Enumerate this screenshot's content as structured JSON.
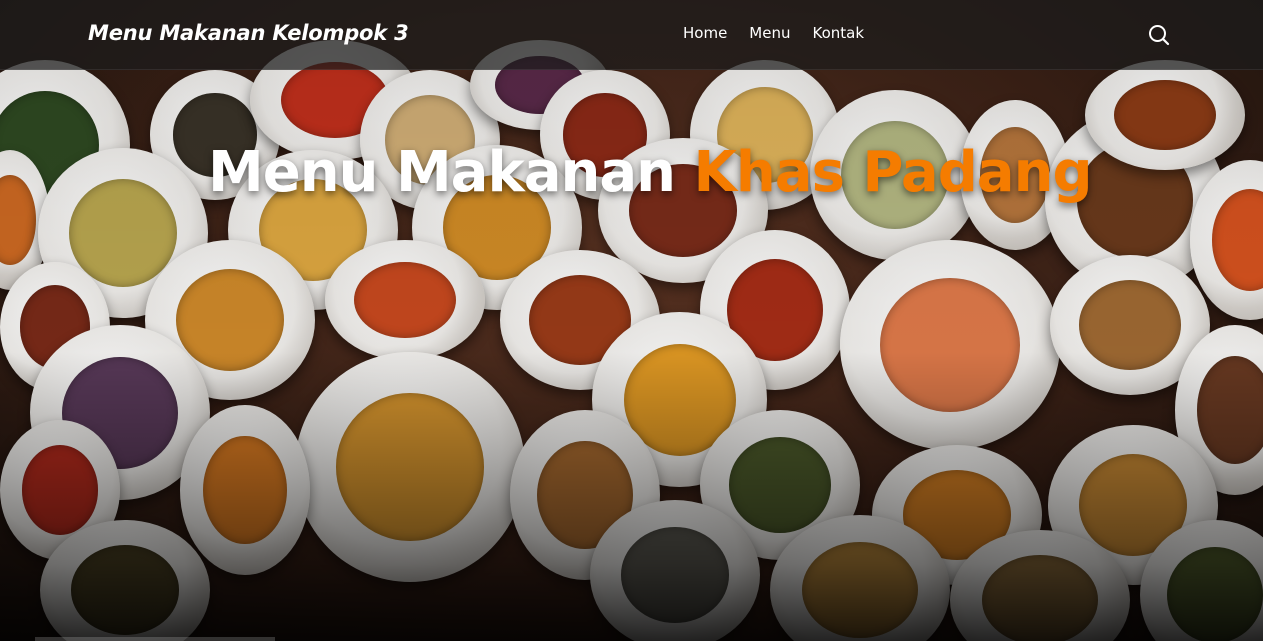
{
  "navbar": {
    "brand": "Menu Makanan Kelompok 3",
    "links": [
      {
        "label": "Home"
      },
      {
        "label": "Menu"
      },
      {
        "label": "Kontak"
      }
    ],
    "search_icon": "search-icon"
  },
  "hero": {
    "title_part1": "Menu Makanan ",
    "title_part2": "Khas Padang",
    "background": "top-down photo of many white plates of Padang dishes on a wooden table"
  },
  "colors": {
    "accent": "#f57c00",
    "navbar_bg": "#1c1c1c",
    "text": "#ffffff"
  }
}
